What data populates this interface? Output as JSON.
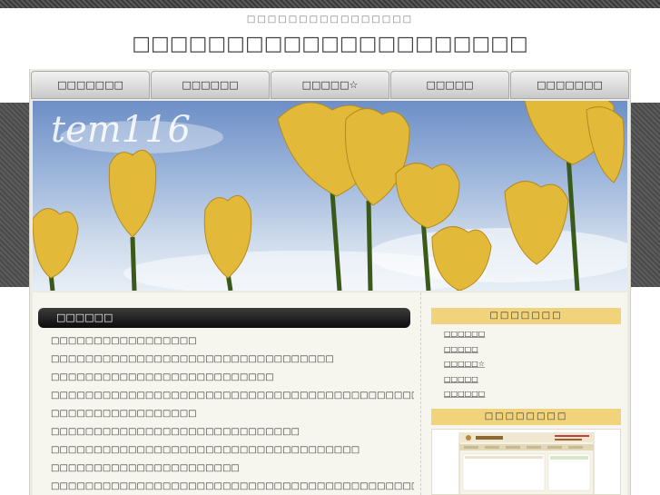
{
  "header": {
    "site_description": "□□□□□□□□□□□□□□□□",
    "site_title": "□□□□□□□□□□□□□□□□□□□□□",
    "logo_text": "tem116"
  },
  "nav": {
    "items": [
      {
        "label": "□□□□□□□"
      },
      {
        "label": "□□□□□□"
      },
      {
        "label": "□□□□□☆"
      },
      {
        "label": "□□□□□"
      },
      {
        "label": "□□□□□□□"
      }
    ]
  },
  "main": {
    "section_title": "□□□□□□",
    "posts": [
      {
        "title": "□□□□□□□□□□□□□□□□□"
      },
      {
        "title": "□□□□□□□□□□□□□□□□□□□□□□□□□□□□□□□□□"
      },
      {
        "title": "□□□□□□□□□□□□□□□□□□□□□□□□□□"
      },
      {
        "title": "□□□□□□□□□□□□□□□□□□□□□□□□□□□□□□□□□□□□□□□□□□□□□□□"
      },
      {
        "title": "□□□□□□□□□□□□□□□□□"
      },
      {
        "title": "□□□□□□□□□□□□□□□□□□□□□□□□□□□□□"
      },
      {
        "title": "□□□□□□□□□□□□□□□□□□□□□□□□□□□□□□□□□□□□"
      },
      {
        "title": "□□□□□□□□□□□□□□□□□□□□□□"
      },
      {
        "title": "□□□□□□□□□□□□□□□□□□□□□□□□□□□□□□□□□□□□□□□□□□□□"
      }
    ]
  },
  "sidebar": {
    "menu_title": "□□□□□□□",
    "menu_items": [
      {
        "label": "□□□□□□"
      },
      {
        "label": "□□□□□"
      },
      {
        "label": "□□□□□☆"
      },
      {
        "label": "□□□□□"
      },
      {
        "label": "□□□□□□"
      }
    ],
    "banner_title": "□□□□□□□□"
  },
  "colors": {
    "accent_yellow": "#f0d37a",
    "nav_gradient_top": "#f2f2f2",
    "nav_gradient_bottom": "#c9c9c9",
    "dark_head": "#1c1c1c"
  }
}
